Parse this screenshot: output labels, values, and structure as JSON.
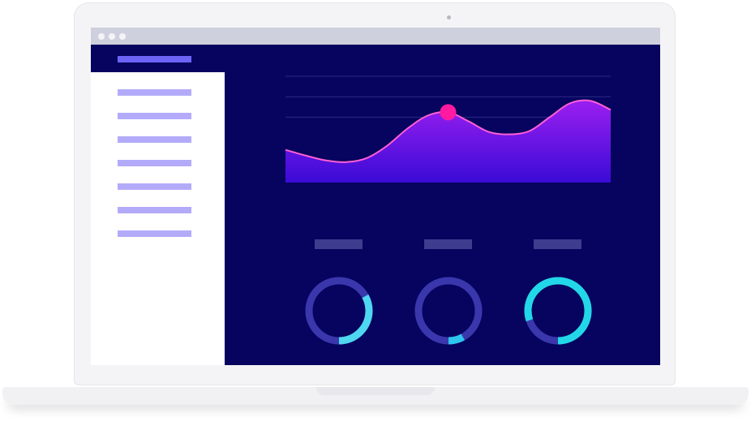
{
  "screen": {
    "background": "#06045f",
    "sidebar_background": "#ffffff",
    "sidebar_item_color": "#b3abf9",
    "nav_bar_color": "#6e63f7",
    "titlebar_color": "#cfd0de"
  },
  "sidebar": {
    "items": [
      "",
      "",
      "",
      "",
      "",
      "",
      ""
    ]
  },
  "chart_data": {
    "type": "area",
    "title": "",
    "xlabel": "",
    "ylabel": "",
    "x": [
      0,
      1,
      2,
      3,
      4,
      5,
      6,
      7,
      8,
      9,
      10,
      11,
      12,
      13,
      14,
      15,
      16
    ],
    "values": [
      0.4,
      0.33,
      0.27,
      0.25,
      0.3,
      0.45,
      0.66,
      0.82,
      0.86,
      0.75,
      0.62,
      0.59,
      0.63,
      0.8,
      0.97,
      1.0,
      0.89
    ],
    "ylim": [
      0,
      1.3
    ],
    "highlight_index": 8,
    "grid": true,
    "fill_top_color": "#9b1ff0",
    "fill_bottom_color": "#3a0bd6",
    "line_color": "#ff5fd4",
    "marker_color": "#ff1aa0"
  },
  "gauges": [
    {
      "name": "",
      "value": 0.33,
      "color": "#4fd6f0"
    },
    {
      "name": "",
      "value": 0.08,
      "color": "#2ec5ef"
    },
    {
      "name": "",
      "value": 0.8,
      "color": "#22d8e8"
    }
  ],
  "gauge_track_color": "#3a37ad"
}
